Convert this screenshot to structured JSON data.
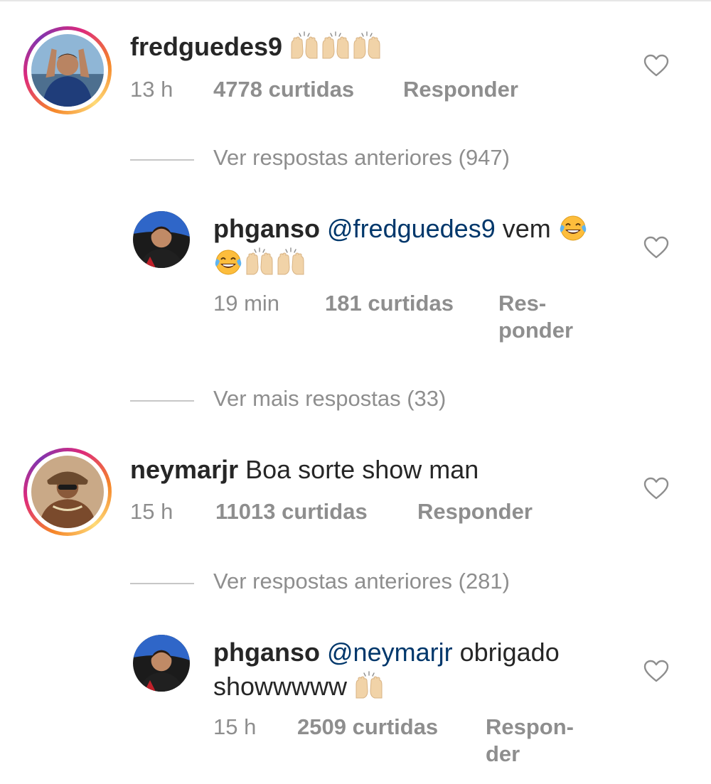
{
  "comments": [
    {
      "username": "fredguedes9",
      "text": "",
      "emojis": [
        "raising-hands",
        "raising-hands",
        "raising-hands"
      ],
      "time": "13 h",
      "likes": "4778 curtidas",
      "reply_label": "Responder"
    },
    {
      "username": "phganso",
      "mention": "@fredguedes9",
      "text": "vem",
      "emojis": [
        "tears-of-joy",
        "tears-of-joy",
        "raising-hands",
        "raising-hands"
      ],
      "time": "19 min",
      "likes": "181 curtidas",
      "reply_label_line1": "Res-",
      "reply_label_line2": "ponder"
    },
    {
      "username": "neymarjr",
      "text": "Boa sorte show man",
      "time": "15 h",
      "likes": "11013 curtidas",
      "reply_label": "Responder"
    },
    {
      "username": "phganso",
      "mention": "@neymarjr",
      "text": "obrigado",
      "text_line2": "showwwww",
      "emojis": [
        "raising-hands"
      ],
      "time": "15 h",
      "likes": "2509 curtidas",
      "reply_label_line1": "Respon-",
      "reply_label_line2": "der"
    }
  ],
  "view_more": [
    {
      "label": "Ver respostas anteriores (947)"
    },
    {
      "label": "Ver mais respostas (33)"
    },
    {
      "label": "Ver respostas anteriores (281)"
    }
  ],
  "colors": {
    "username": "#262626",
    "mention": "#00376b",
    "meta": "#8e8e8e",
    "story_ring": [
      "#f58529",
      "#dd2a7b",
      "#8134af"
    ]
  },
  "icons": [
    "heart-outline-icon",
    "raising-hands-emoji",
    "tears-of-joy-emoji"
  ]
}
